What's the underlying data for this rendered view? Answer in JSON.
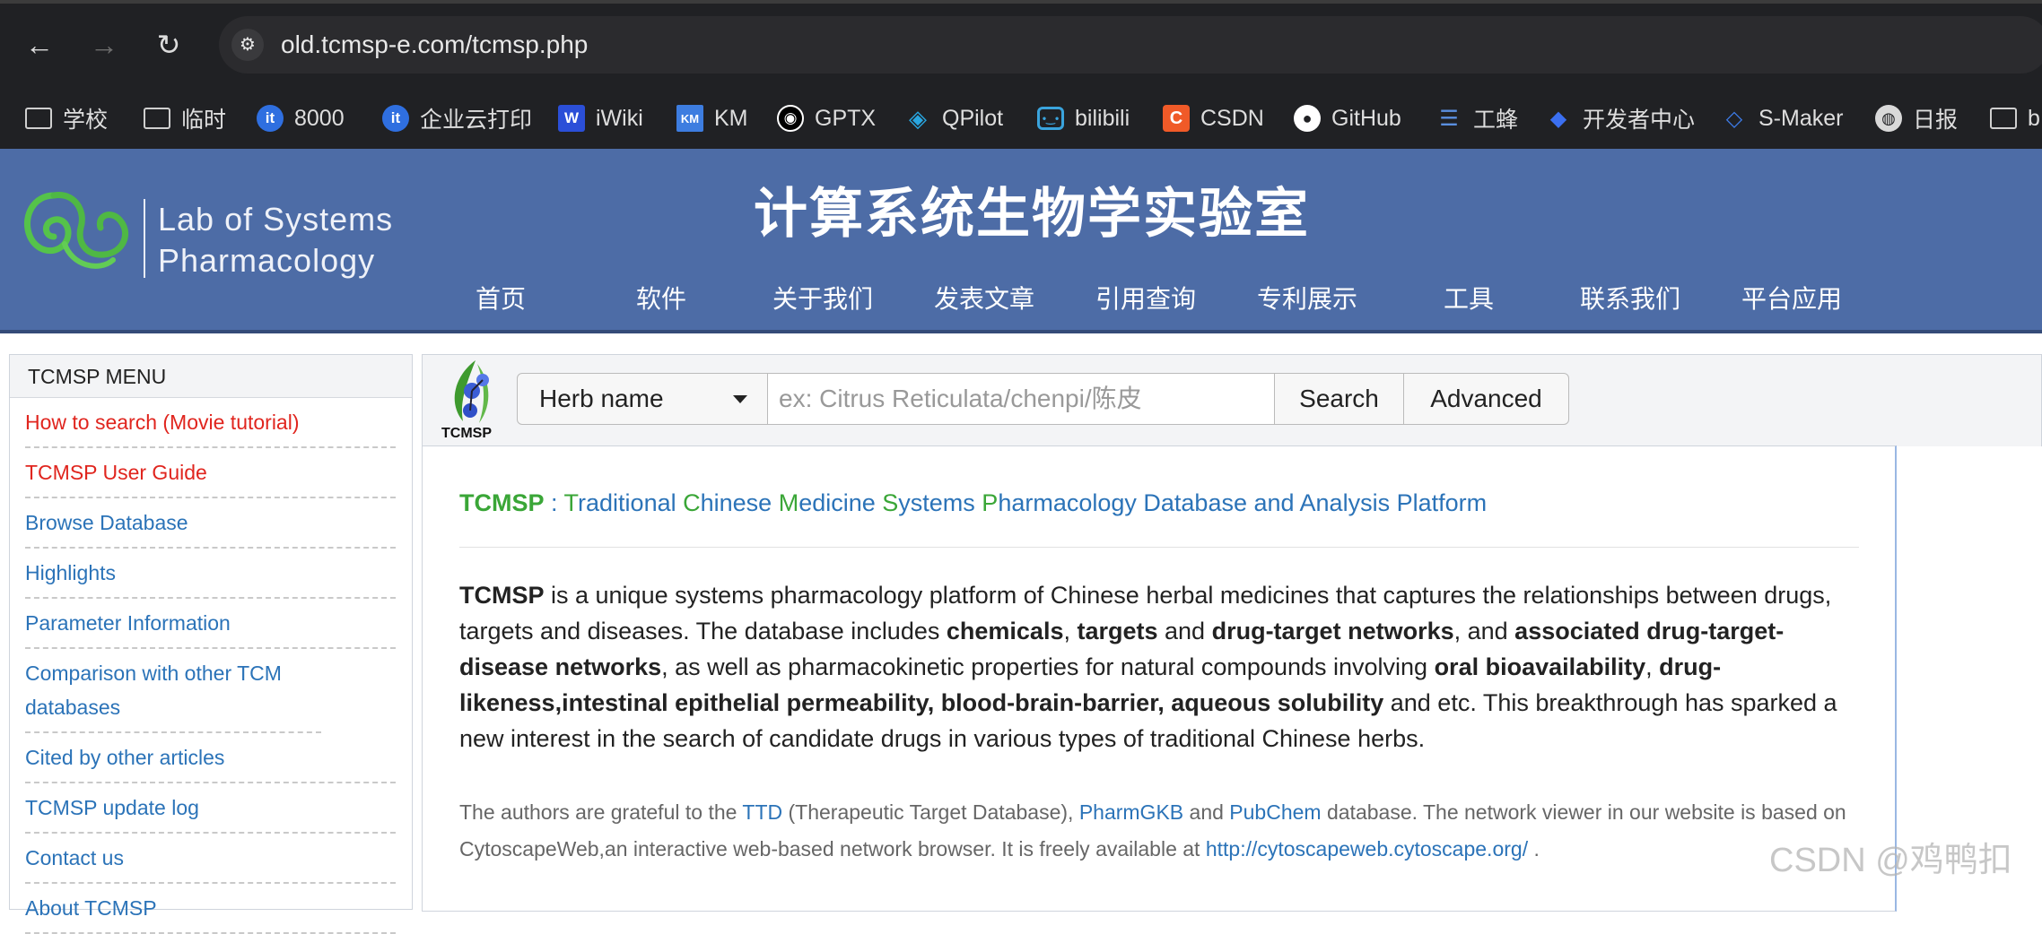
{
  "browser": {
    "url": "old.tcmsp-e.com/tcmsp.php",
    "back_icon": "←",
    "forward_icon": "→",
    "reload_icon": "↻",
    "tune_icon": "⚙",
    "bookmarks": [
      {
        "label": "学校",
        "icon": "folder"
      },
      {
        "label": "临时",
        "icon": "folder"
      },
      {
        "label": "8000",
        "icon": "it",
        "glyph": "it"
      },
      {
        "label": "企业云打印",
        "icon": "it",
        "glyph": "it"
      },
      {
        "label": "iWiki",
        "icon": "w",
        "glyph": "W"
      },
      {
        "label": "KM",
        "icon": "km",
        "glyph": "KM"
      },
      {
        "label": "GPTX",
        "icon": "gptx",
        "glyph": "◉"
      },
      {
        "label": "QPilot",
        "icon": "qp",
        "glyph": "◈"
      },
      {
        "label": "bilibili",
        "icon": "bili",
        "glyph": "•‿•"
      },
      {
        "label": "CSDN",
        "icon": "csdn",
        "glyph": "C"
      },
      {
        "label": "GitHub",
        "icon": "gh",
        "glyph": "●"
      },
      {
        "label": "工蜂",
        "icon": "gf",
        "glyph": "☰"
      },
      {
        "label": "开发者中心",
        "icon": "dev",
        "glyph": "◆"
      },
      {
        "label": "S-Maker",
        "icon": "sm",
        "glyph": "◇"
      },
      {
        "label": "日报",
        "icon": "globe",
        "glyph": "◍"
      },
      {
        "label": "b",
        "icon": "folder"
      }
    ]
  },
  "site": {
    "logo_line1": "Lab of Systems",
    "logo_line2": "Pharmacology",
    "title": "计算系统生物学实验室",
    "nav": [
      "首页",
      "软件",
      "关于我们",
      "发表文章",
      "引用查询",
      "专利展示",
      "工具",
      "联系我们",
      "平台应用"
    ]
  },
  "sidebar": {
    "heading": "TCMSP MENU",
    "items": [
      {
        "label": "How to search (Movie tutorial)",
        "red": true
      },
      {
        "label": "TCMSP User Guide",
        "red": true
      },
      {
        "label": "Browse Database",
        "red": false
      },
      {
        "label": "Highlights",
        "red": false
      },
      {
        "label": "Parameter Information",
        "red": false
      },
      {
        "label": "Comparison with other TCM databases",
        "red": false
      },
      {
        "label": "Cited by other articles",
        "red": false
      },
      {
        "label": "TCMSP update log",
        "red": false
      },
      {
        "label": "Contact us",
        "red": false
      },
      {
        "label": "About TCMSP",
        "red": false
      }
    ]
  },
  "search": {
    "logo_text": "TCMSP",
    "type_selected": "Herb name",
    "placeholder": "ex: Citrus Reticulata/chenpi/陈皮",
    "search_label": "Search",
    "advanced_label": "Advanced"
  },
  "content": {
    "title_brand": "TCMSP",
    "title_sep": " : ",
    "title_words": [
      {
        "first": "T",
        "rest": "raditional "
      },
      {
        "first": "C",
        "rest": "hinese "
      },
      {
        "first": "M",
        "rest": "edicine "
      },
      {
        "first": "S",
        "rest": "ystems "
      },
      {
        "first": "P",
        "rest": "harmacology Database and Analysis Platform"
      }
    ],
    "paragraph": [
      {
        "t": "TCMSP",
        "b": true
      },
      {
        "t": " is a unique systems pharmacology platform of Chinese herbal medicines that captures the relationships between drugs, targets and diseases. The database includes ",
        "b": false
      },
      {
        "t": "chemicals",
        "b": true
      },
      {
        "t": ", ",
        "b": false
      },
      {
        "t": "targets",
        "b": true
      },
      {
        "t": " and ",
        "b": false
      },
      {
        "t": "drug-target networks",
        "b": true
      },
      {
        "t": ", and ",
        "b": false
      },
      {
        "t": "associated drug-target-disease networks",
        "b": true
      },
      {
        "t": ", as well as pharmacokinetic properties for natural compounds involving ",
        "b": false
      },
      {
        "t": "oral bioavailability",
        "b": true
      },
      {
        "t": ", ",
        "b": false
      },
      {
        "t": "drug-likeness,intestinal epithelial permeability, blood-brain-barrier,  aqueous solubility",
        "b": true
      },
      {
        "t": " and etc. This breakthrough has sparked a new interest in the search of candidate drugs in various types of traditional Chinese herbs.",
        "b": false
      }
    ],
    "ack": [
      {
        "t": "The authors are grateful to the ",
        "l": false
      },
      {
        "t": "TTD",
        "l": true
      },
      {
        "t": " (Therapeutic Target Database), ",
        "l": false
      },
      {
        "t": "PharmGKB",
        "l": true
      },
      {
        "t": " and ",
        "l": false
      },
      {
        "t": "PubChem",
        "l": true
      },
      {
        "t": " database. The network viewer in our website is based on CytoscapeWeb,an interactive web-based network browser. It is freely available at ",
        "l": false
      },
      {
        "t": "http://cytoscapeweb.cytoscape.org/",
        "l": true
      },
      {
        "t": " .",
        "l": false
      }
    ]
  },
  "watermark": "CSDN @鸡鸭扣",
  "colors": {
    "header_bg": "#4d6ca6",
    "link": "#2b73b8",
    "red": "#e0251e",
    "green": "#3aa637"
  }
}
